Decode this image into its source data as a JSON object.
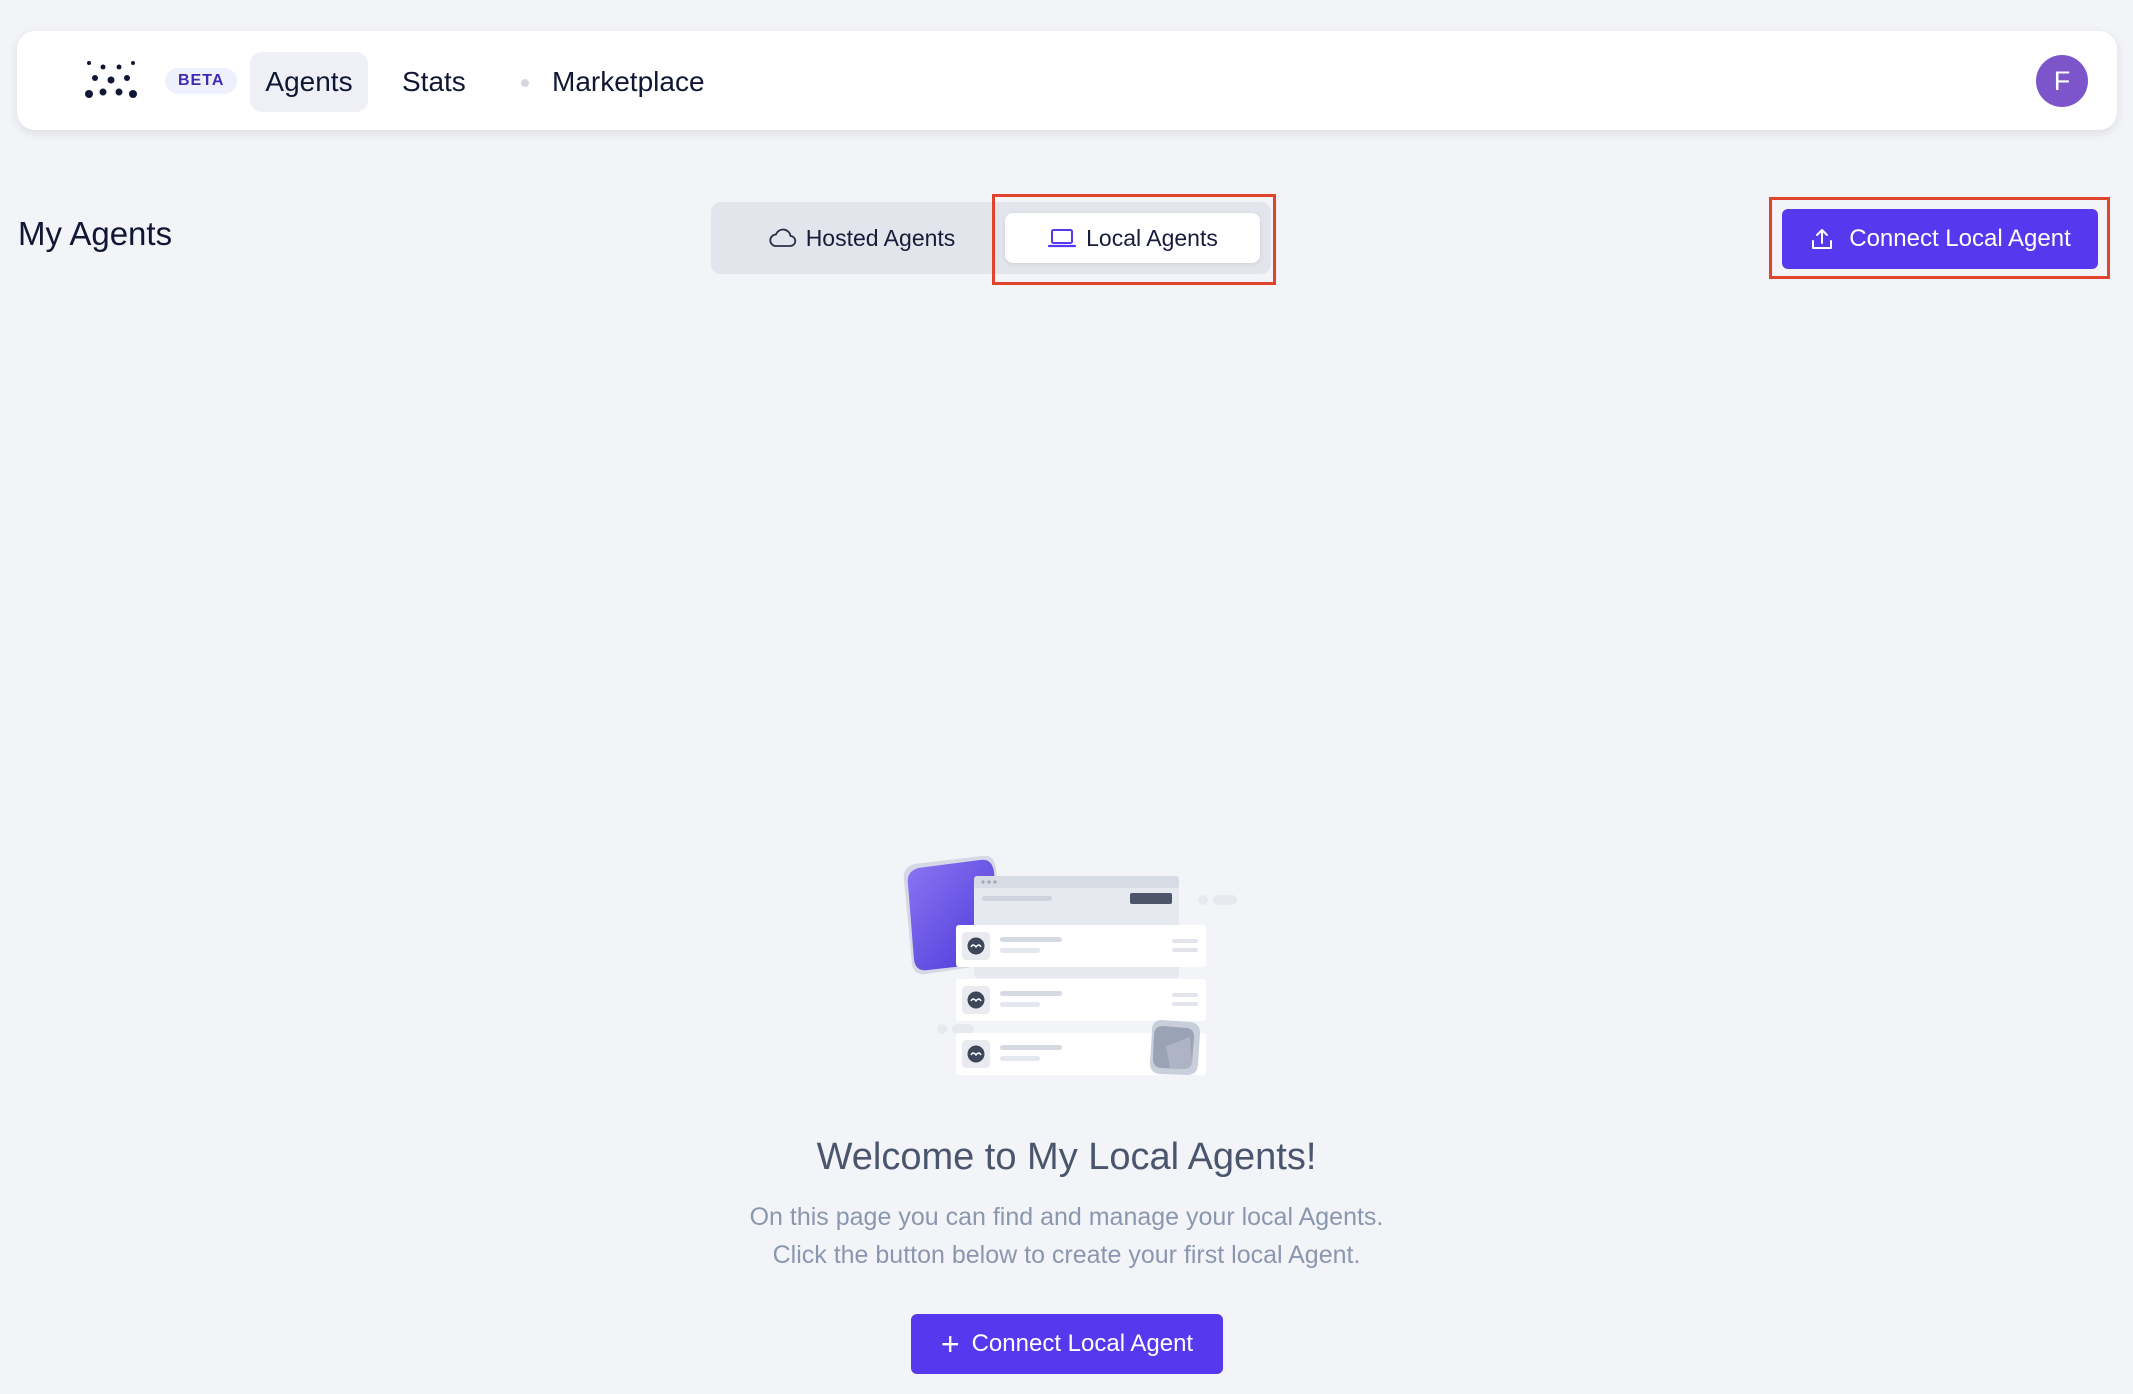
{
  "nav": {
    "badge": "BETA",
    "items": [
      {
        "label": "Agents",
        "active": true
      },
      {
        "label": "Stats"
      },
      {
        "label": "Marketplace"
      }
    ],
    "avatar_initial": "F"
  },
  "page": {
    "title": "My Agents"
  },
  "tabs": [
    {
      "label": "Hosted Agents",
      "icon": "cloud-icon",
      "active": false
    },
    {
      "label": "Local Agents",
      "icon": "laptop-icon",
      "active": true
    }
  ],
  "actions": {
    "connect_top": {
      "label": "Connect Local Agent",
      "icon": "upload-icon"
    },
    "connect_bottom": {
      "label": "Connect Local Agent",
      "icon": "plus-icon"
    }
  },
  "empty_state": {
    "title": "Welcome to My Local Agents!",
    "line1": "On this page you can find and manage your local Agents.",
    "line2": "Click the button below to create your first local Agent."
  },
  "colors": {
    "primary": "#5638ee",
    "highlight": "#e1442c",
    "avatar": "#7b55c9",
    "background": "#f3f4f7"
  }
}
